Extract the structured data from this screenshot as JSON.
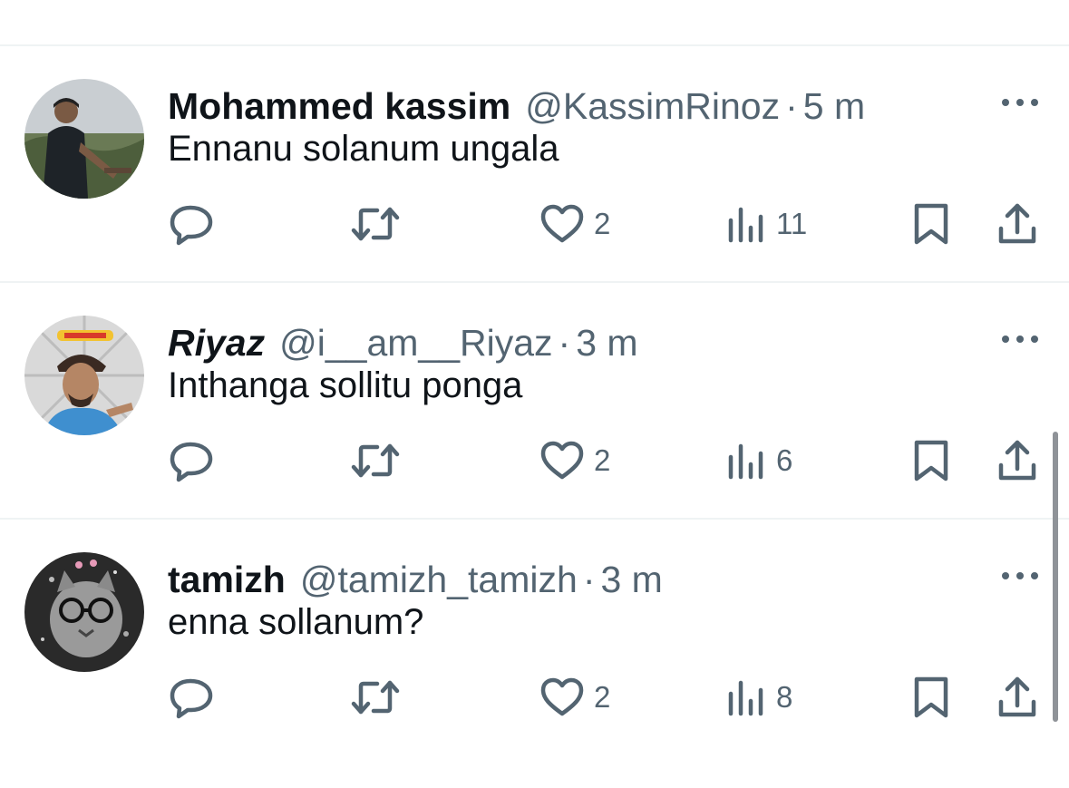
{
  "tweets": [
    {
      "name": "Mohammed kassim",
      "name_italic": false,
      "handle": "@KassimRinoz",
      "separator": "·",
      "time": "5 m",
      "text": "Ennanu solanum ungala",
      "likes": "2",
      "views": "11",
      "avatar": "person-standing-outdoors"
    },
    {
      "name": "Riyaz",
      "name_italic": true,
      "handle": "@i__am__Riyaz",
      "separator": "·",
      "time": "3 m",
      "text": "Inthanga sollitu ponga",
      "likes": "2",
      "views": "6",
      "avatar": "cartoon-man-blue-shirt"
    },
    {
      "name": "tamizh",
      "name_italic": false,
      "handle": "@tamizh_tamizh",
      "separator": "·",
      "time": "3 m",
      "text": "enna sollanum?",
      "likes": "2",
      "views": "8",
      "avatar": "cat-with-glasses"
    }
  ],
  "icons": {
    "more": "more-horizontal-icon",
    "reply": "reply-icon",
    "retweet": "retweet-icon",
    "like": "heart-icon",
    "views": "views-chart-icon",
    "bookmark": "bookmark-icon",
    "share": "share-icon"
  },
  "colors": {
    "text": "#0f1419",
    "secondary": "#536471",
    "divider": "#eff3f4"
  }
}
